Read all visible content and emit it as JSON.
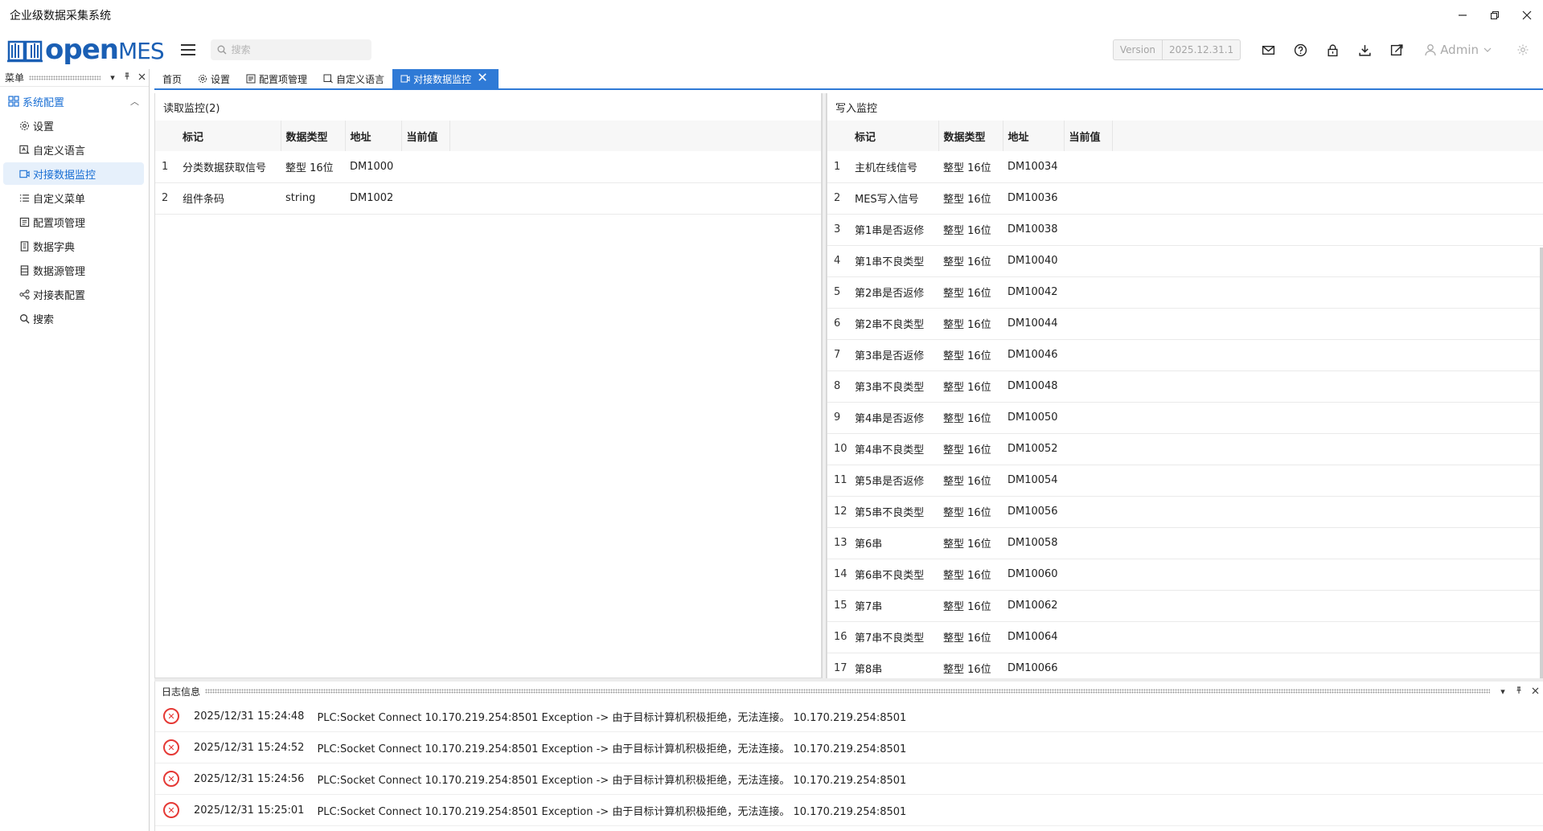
{
  "window": {
    "title": "企业级数据采集系统"
  },
  "header": {
    "logo_open": "open",
    "logo_mes": "MES",
    "search_placeholder": "搜索",
    "version_label": "Version",
    "version_value": "2025.12.31.1",
    "user": "Admin"
  },
  "menu_panel": {
    "title": "菜单"
  },
  "nav": {
    "group": "系统配置",
    "items": [
      {
        "label": "设置",
        "icon": "gear-icon"
      },
      {
        "label": "自定义语言",
        "icon": "language-icon"
      },
      {
        "label": "对接数据监控",
        "icon": "monitor-icon",
        "active": true
      },
      {
        "label": "自定义菜单",
        "icon": "list-icon"
      },
      {
        "label": "配置项管理",
        "icon": "config-icon"
      },
      {
        "label": "数据字典",
        "icon": "dictionary-icon"
      },
      {
        "label": "数据源管理",
        "icon": "datasource-icon"
      },
      {
        "label": "对接表配置",
        "icon": "share-icon"
      },
      {
        "label": "搜索",
        "icon": "search-icon"
      }
    ]
  },
  "tabs": [
    {
      "label": "首页"
    },
    {
      "label": "设置"
    },
    {
      "label": "配置项管理"
    },
    {
      "label": "自定义语言"
    },
    {
      "label": "对接数据监控",
      "active": true
    }
  ],
  "read_monitor": {
    "title": "读取监控(2)",
    "columns": [
      "标记",
      "数据类型",
      "地址",
      "当前值"
    ],
    "rows": [
      {
        "idx": "1",
        "tag": "分类数据获取信号",
        "type": "整型 16位",
        "addr": "DM1000",
        "value": ""
      },
      {
        "idx": "2",
        "tag": "组件条码",
        "type": "string",
        "addr": "DM1002",
        "value": ""
      }
    ]
  },
  "write_monitor": {
    "title": "写入监控",
    "columns": [
      "标记",
      "数据类型",
      "地址",
      "当前值"
    ],
    "rows": [
      {
        "idx": "1",
        "tag": "主机在线信号",
        "type": "整型 16位",
        "addr": "DM10034",
        "value": ""
      },
      {
        "idx": "2",
        "tag": "MES写入信号",
        "type": "整型 16位",
        "addr": "DM10036",
        "value": ""
      },
      {
        "idx": "3",
        "tag": "第1串是否返修",
        "type": "整型 16位",
        "addr": "DM10038",
        "value": ""
      },
      {
        "idx": "4",
        "tag": "第1串不良类型",
        "type": "整型 16位",
        "addr": "DM10040",
        "value": ""
      },
      {
        "idx": "5",
        "tag": "第2串是否返修",
        "type": "整型 16位",
        "addr": "DM10042",
        "value": ""
      },
      {
        "idx": "6",
        "tag": "第2串不良类型",
        "type": "整型 16位",
        "addr": "DM10044",
        "value": ""
      },
      {
        "idx": "7",
        "tag": "第3串是否返修",
        "type": "整型 16位",
        "addr": "DM10046",
        "value": ""
      },
      {
        "idx": "8",
        "tag": "第3串不良类型",
        "type": "整型 16位",
        "addr": "DM10048",
        "value": ""
      },
      {
        "idx": "9",
        "tag": "第4串是否返修",
        "type": "整型 16位",
        "addr": "DM10050",
        "value": ""
      },
      {
        "idx": "10",
        "tag": "第4串不良类型",
        "type": "整型 16位",
        "addr": "DM10052",
        "value": ""
      },
      {
        "idx": "11",
        "tag": "第5串是否返修",
        "type": "整型 16位",
        "addr": "DM10054",
        "value": ""
      },
      {
        "idx": "12",
        "tag": "第5串不良类型",
        "type": "整型 16位",
        "addr": "DM10056",
        "value": ""
      },
      {
        "idx": "13",
        "tag": "第6串",
        "type": "整型 16位",
        "addr": "DM10058",
        "value": ""
      },
      {
        "idx": "14",
        "tag": "第6串不良类型",
        "type": "整型 16位",
        "addr": "DM10060",
        "value": ""
      },
      {
        "idx": "15",
        "tag": "第7串",
        "type": "整型 16位",
        "addr": "DM10062",
        "value": ""
      },
      {
        "idx": "16",
        "tag": "第7串不良类型",
        "type": "整型 16位",
        "addr": "DM10064",
        "value": ""
      },
      {
        "idx": "17",
        "tag": "第8串",
        "type": "整型 16位",
        "addr": "DM10066",
        "value": ""
      }
    ]
  },
  "log_panel": {
    "title": "日志信息",
    "entries": [
      {
        "time": "2025/12/31 15:24:48",
        "message": "PLC:Socket Connect 10.170.219.254:8501 Exception -> 由于目标计算机积极拒绝，无法连接。 10.170.219.254:8501"
      },
      {
        "time": "2025/12/31 15:24:52",
        "message": "PLC:Socket Connect 10.170.219.254:8501 Exception -> 由于目标计算机积极拒绝，无法连接。 10.170.219.254:8501"
      },
      {
        "time": "2025/12/31 15:24:56",
        "message": "PLC:Socket Connect 10.170.219.254:8501 Exception -> 由于目标计算机积极拒绝，无法连接。 10.170.219.254:8501"
      },
      {
        "time": "2025/12/31 15:25:01",
        "message": "PLC:Socket Connect 10.170.219.254:8501 Exception -> 由于目标计算机积极拒绝，无法连接。 10.170.219.254:8501"
      }
    ]
  },
  "colors": {
    "accent": "#2f7ad6",
    "brand": "#1a5fb4",
    "error": "#e53935"
  }
}
